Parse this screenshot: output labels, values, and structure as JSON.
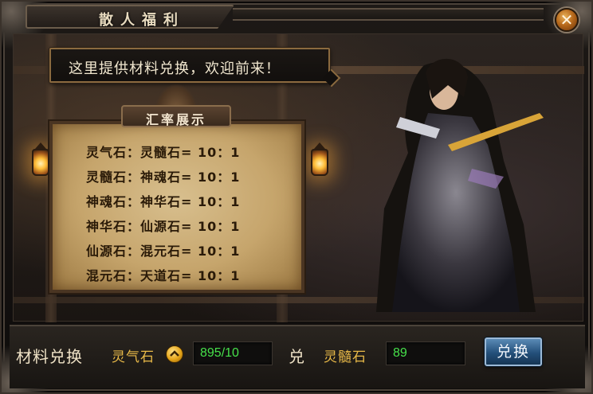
{
  "window": {
    "title": "散人福利",
    "close_icon": "close-icon"
  },
  "npc": {
    "greeting": "这里提供材料兑换，欢迎前来！"
  },
  "board": {
    "title": "汇率展示",
    "rates": [
      "灵气石：灵髓石= 10：1",
      "灵髓石：神魂石= 10：1",
      "神魂石：神华石= 10：1",
      "神华石：仙源石= 10：1",
      "仙源石：混元石= 10：1",
      "混元石：天道石= 10：1"
    ]
  },
  "exchange": {
    "label": "材料兑换",
    "from_item": "灵气石",
    "from_amount": "895/10",
    "arrow_label": "兑",
    "to_item": "灵髓石",
    "to_amount": "89",
    "button_label": "兑换"
  },
  "colors": {
    "accent_gold": "#e8b948",
    "value_green": "#46e14a",
    "button_blue": "#234f7a"
  }
}
